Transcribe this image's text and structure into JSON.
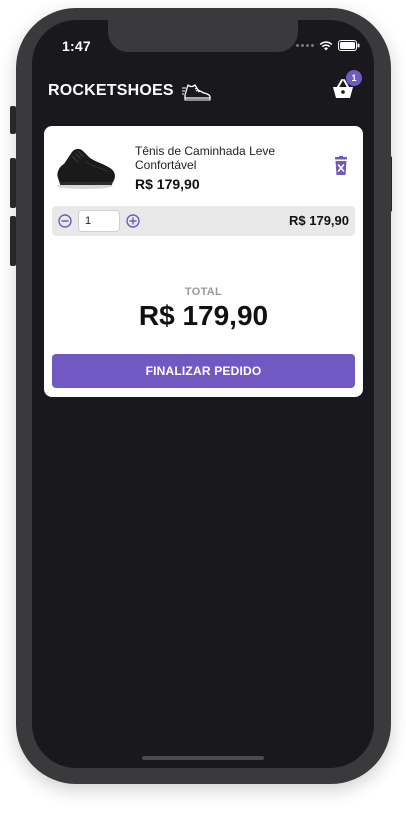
{
  "status_bar": {
    "time": "1:47"
  },
  "header": {
    "logo_text": "ROCKETSHOES",
    "cart_count": "1"
  },
  "cart": {
    "items": [
      {
        "title": "Tênis de Caminhada Leve Confortável",
        "price": "R$ 179,90",
        "quantity": "1",
        "subtotal": "R$ 179,90"
      }
    ],
    "total_label": "TOTAL",
    "total_value": "R$ 179,90",
    "checkout_label": "FINALIZAR PEDIDO"
  },
  "icons": {
    "logo": "sneaker-icon",
    "cart": "basket-icon",
    "delete": "trash-icon",
    "decrement": "minus-circle-icon",
    "increment": "plus-circle-icon"
  },
  "colors": {
    "background": "#19181d",
    "accent": "#7159c1",
    "card": "#ffffff",
    "quantity_bar": "#e9e9e9"
  }
}
